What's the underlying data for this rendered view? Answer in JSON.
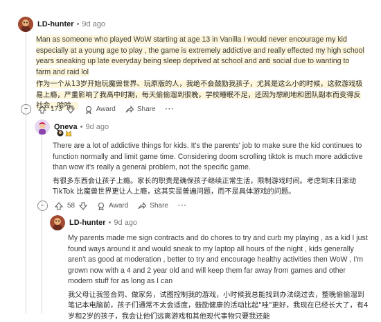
{
  "comments": [
    {
      "username": "LD-hunter",
      "time": "9d ago",
      "text_en": "Man as someone who played WoW starting at age 13 in Vanilla I would never encourage my kid especially at a young age to play , the game is extremely addictive and really effected my high school years sneaking up late everyday being sleep deprived at school and anti social due to wanting to farm and raid lol",
      "text_cn": "作为一个从13岁开始玩魔兽世界、玩原版的人，我绝不会鼓励我孩子，尤其是这么小的时候，这款游戏极易上瘾，严重影响了我高中时期，每天偷偷溜到很晚，学校睡眠不足，还因为想刷地和团队副本而变得反社会，哈哈。",
      "votes": "173",
      "award_label": "Award",
      "share_label": "Share"
    },
    {
      "username": "Qneva",
      "time": "9d ago",
      "text_en": "There are a lot of addictive things for kids. It's the parents' job to make sure the kid continues to function normally and limit game time. Considering doom scrolling tiktok is much more addictive than wow it's really a general problem, not the specific game.",
      "text_cn": "有很多东西会让孩子上瘾。家长的职责是确保孩子继续正常生活，限制游戏时间。考虑到末日滚动 TikTok 比魔兽世界更让人上瘾，这其实是普遍问题，而不是具体游戏的问题。",
      "votes": "58",
      "award_label": "Award",
      "share_label": "Share"
    },
    {
      "username": "LD-hunter",
      "time": "9d ago",
      "text_en": "My parents made me sign contracts and do chores to try and curb my playing , as a kid I just found ways around it and would sneak to my laptop all hours of the night , kids generally aren't as good at moderation , better to try and encourage healthy activities then WoW , I'm grown now with a 4 and 2 year old and will keep them far away from games and other modern stuff for as long as I can",
      "text_cn": "我父母让我签合同、做家务，试图控制我的游戏，小时候我总能找到办法绕过去，整晚偷偷溜到笔记本电脑前，孩子们通常不太会适度，鼓励健康的活动比起\"哇\"更好，我现在已经长大了，有4岁和2岁的孩子，我会让他们远离游戏和其他现代事物只要我还能"
    }
  ],
  "colors": {
    "highlight": "#fdf6da",
    "thread_line": "#d6d6d6",
    "meta_text": "#7c7c7c"
  }
}
